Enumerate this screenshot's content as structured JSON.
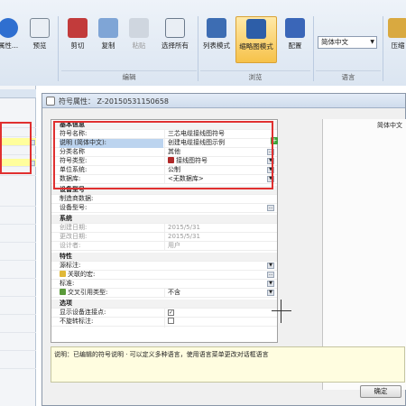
{
  "ribbon": {
    "buttons": [
      {
        "label": "属性...",
        "icon": "info-icon"
      },
      {
        "label": "预览",
        "icon": "preview-icon"
      },
      {
        "label": "剪切",
        "icon": "scissors-icon"
      },
      {
        "label": "复制",
        "icon": "copy-icon"
      },
      {
        "label": "粘贴",
        "icon": "paste-icon"
      },
      {
        "label": "选择所有",
        "icon": "select-all-icon"
      },
      {
        "label": "列表模式",
        "icon": "list-mode-icon"
      },
      {
        "label": "缩略图模式",
        "icon": "thumbnail-mode-icon"
      },
      {
        "label": "配置",
        "icon": "config-icon"
      },
      {
        "label": "压缩",
        "icon": "compress-icon"
      }
    ],
    "groups": {
      "edit": "编辑",
      "browse": "浏览",
      "language": "语言"
    },
    "language_select": "简体中文"
  },
  "dialog": {
    "title": "符号属性：  Z-20150531150658",
    "right_panel_value": "简体中文",
    "ok_label": "确定",
    "description": "说明：已编辑的符号说明 · 可以定义多种语言，使用语言菜单更改对话框语言",
    "categories": {
      "basic": "基本信息",
      "device": "设备型号",
      "system": "系统",
      "props": "特性",
      "options": "选项"
    },
    "basic_rows": [
      {
        "name": "符号名称:",
        "value": "三芯电缆接线图符号"
      },
      {
        "name": "说明 (简体中文):",
        "value": "创建电缆接线图示例"
      },
      {
        "name": "分类名称",
        "value": "其他"
      },
      {
        "name": "符号类型:",
        "value": "接线图符号"
      },
      {
        "name": "单位系统:",
        "value": "公制"
      },
      {
        "name": "数据库:",
        "value": "<无数据库>"
      }
    ],
    "device_rows": [
      {
        "name": "制造商数据:",
        "value": ""
      },
      {
        "name": "设备型号:",
        "value": ""
      }
    ],
    "system_rows": [
      {
        "name": "创建日期:",
        "value": "2015/5/31"
      },
      {
        "name": "更改日期:",
        "value": "2015/5/31"
      },
      {
        "name": "设计者:",
        "value": "用户"
      }
    ],
    "prop_rows": [
      {
        "name": "源标注:",
        "value": ""
      },
      {
        "name": "关联的宏:",
        "value": ""
      },
      {
        "name": "标准:",
        "value": ""
      },
      {
        "name": "交叉引用类型:",
        "value": "不含"
      }
    ],
    "option_rows": [
      {
        "name": "显示设备连接点:",
        "value": "✓"
      },
      {
        "name": "不旋转标注:",
        "value": ""
      }
    ]
  }
}
